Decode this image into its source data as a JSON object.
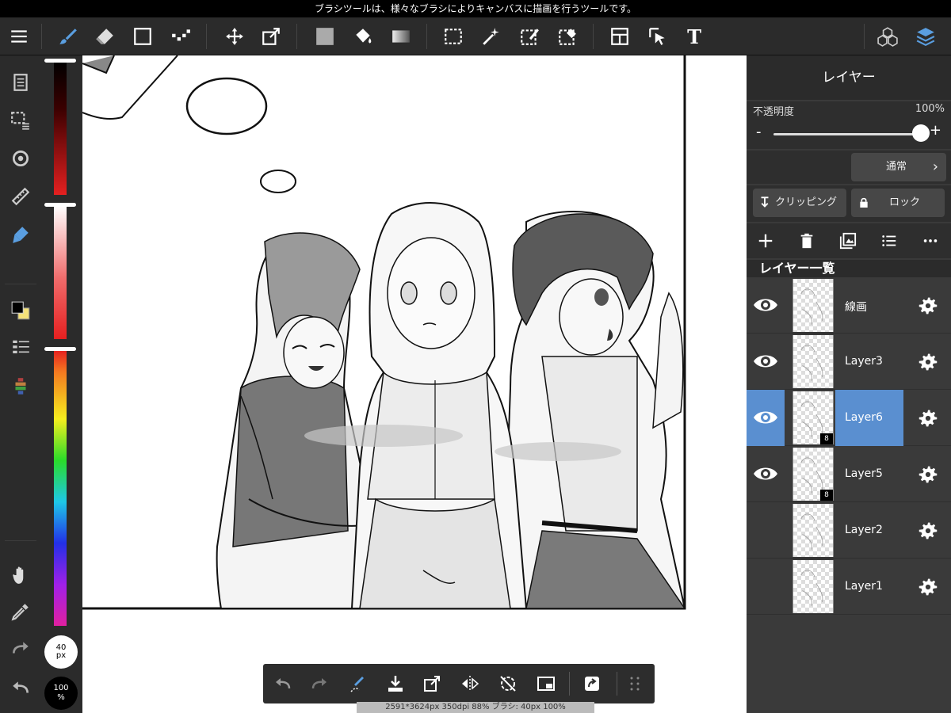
{
  "statusbar": {
    "text": "ブラシツールは、様々なブラシによりキャンバスに描画を行うツールです。"
  },
  "toolbar": {
    "icons": [
      "menu-icon",
      "brush-icon",
      "eraser-icon",
      "shape-icon",
      "dot-line-icon",
      "move-icon",
      "transform-icon",
      "fill-color-icon",
      "bucket-icon",
      "gradient-icon",
      "select-rect-icon",
      "magic-wand-icon",
      "select-pen-icon",
      "select-eraser-icon",
      "layout-icon",
      "select-arrow-icon",
      "text-icon",
      "materials-icon",
      "layers-icon"
    ],
    "text_tool_label": "T"
  },
  "left_tools": {
    "icons": [
      "pages-icon",
      "selection-icon",
      "rotate-icon",
      "ruler-icon",
      "pen-tool-icon",
      "color-swatch-icon",
      "brush-list-icon",
      "palette-icon",
      "hand-icon",
      "eyedropper-icon",
      "redo-icon",
      "undo-icon"
    ]
  },
  "colors": {
    "foreground": "#000000",
    "background": "#f5e27a",
    "accent_blue": "#5a8fd0",
    "panel_bg": "#3a3a3a"
  },
  "brush": {
    "size_line1": "40",
    "size_line2": "px",
    "opacity_line1": "100",
    "opacity_line2": "%"
  },
  "bottombar": {
    "icons": [
      "undo-icon",
      "redo-icon",
      "stabilizer-icon",
      "save-icon",
      "export-icon",
      "flip-icon",
      "rotate-reset-icon",
      "fullscreen-icon",
      "share-icon",
      "grid-menu-icon"
    ],
    "info": "2591*3624px 350dpi 88% ブラシ: 40px 100%"
  },
  "panel": {
    "title": "レイヤー",
    "opacity_label": "不透明度",
    "opacity_value": "100%",
    "opacity_fraction": 1.0,
    "minus": "-",
    "plus": "+",
    "blend_mode": "通常",
    "clipping_label": "クリッピング",
    "lock_label": "ロック",
    "list_header": "レイヤー一覧",
    "layers": [
      {
        "name": "線画",
        "visible": true,
        "selected": false,
        "badge": ""
      },
      {
        "name": "Layer3",
        "visible": true,
        "selected": false,
        "badge": ""
      },
      {
        "name": "Layer6",
        "visible": true,
        "selected": true,
        "badge": "8"
      },
      {
        "name": "Layer5",
        "visible": true,
        "selected": false,
        "badge": "8"
      },
      {
        "name": "Layer2",
        "visible": false,
        "selected": false,
        "badge": ""
      },
      {
        "name": "Layer1",
        "visible": false,
        "selected": false,
        "badge": ""
      }
    ]
  }
}
